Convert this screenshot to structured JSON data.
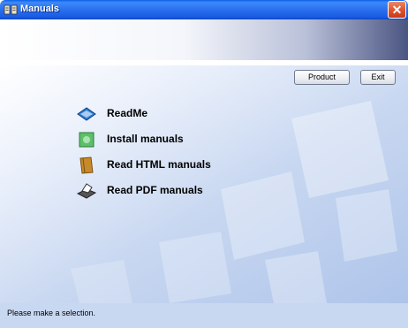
{
  "window": {
    "title": "Manuals"
  },
  "toolbar": {
    "product_label": "Product",
    "exit_label": "Exit"
  },
  "menu": {
    "items": [
      {
        "label": "ReadMe",
        "icon": "readme-icon"
      },
      {
        "label": "Install manuals",
        "icon": "install-manuals-icon"
      },
      {
        "label": "Read HTML manuals",
        "icon": "html-manual-icon"
      },
      {
        "label": "Read PDF manuals",
        "icon": "pdf-manual-icon"
      }
    ]
  },
  "status": {
    "text": "Please make a selection."
  },
  "colors": {
    "titlebar": "#2a6ff0",
    "close": "#e0552e",
    "background": "#c9d8f1"
  }
}
